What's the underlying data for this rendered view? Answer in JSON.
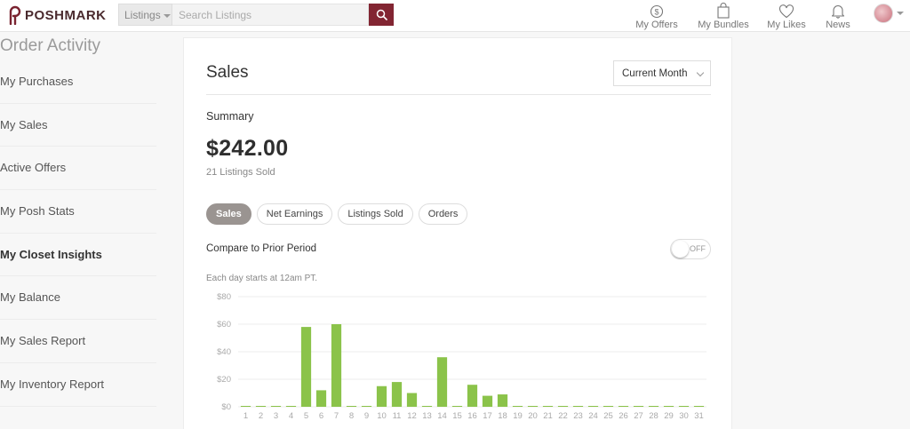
{
  "header": {
    "logo_text": "POSHMARK",
    "search_category": "Listings",
    "search_placeholder": "Search Listings",
    "nav": [
      {
        "label": "My Offers",
        "icon": "offers-icon"
      },
      {
        "label": "My Bundles",
        "icon": "bundle-icon"
      },
      {
        "label": "My Likes",
        "icon": "heart-icon"
      },
      {
        "label": "News",
        "icon": "bell-icon"
      }
    ]
  },
  "sidebar": {
    "title": "Order Activity",
    "items": [
      {
        "label": "My Purchases",
        "bold": false
      },
      {
        "label": "My Sales",
        "bold": false
      },
      {
        "label": "Active Offers",
        "bold": false
      },
      {
        "label": "My Posh Stats",
        "bold": false
      },
      {
        "label": "My Closet Insights",
        "bold": true
      },
      {
        "label": "My Balance",
        "bold": false
      },
      {
        "label": "My Sales Report",
        "bold": false
      },
      {
        "label": "My Inventory Report",
        "bold": false
      }
    ]
  },
  "main": {
    "title": "Sales",
    "period": "Current Month",
    "summary_label": "Summary",
    "amount": "$242.00",
    "listings_sold": "21 Listings Sold",
    "tabs": [
      "Sales",
      "Net Earnings",
      "Listings Sold",
      "Orders"
    ],
    "active_tab": 0,
    "compare_label": "Compare to Prior Period",
    "compare_toggle": "OFF",
    "note": "Each day starts at 12am PT."
  },
  "colors": {
    "brand": "#822532",
    "bar": "#8bc34a",
    "active_pill": "#9a9491"
  },
  "chart_data": {
    "type": "bar",
    "categories": [
      "1",
      "2",
      "3",
      "4",
      "5",
      "6",
      "7",
      "8",
      "9",
      "10",
      "11",
      "12",
      "13",
      "14",
      "15",
      "16",
      "17",
      "18",
      "19",
      "20",
      "21",
      "22",
      "23",
      "24",
      "25",
      "26",
      "27",
      "28",
      "29",
      "30",
      "31"
    ],
    "values": [
      0,
      0,
      0,
      0,
      58,
      12,
      60,
      0,
      0,
      15,
      18,
      10,
      0,
      36,
      0,
      16,
      8,
      9,
      0,
      0,
      0,
      0,
      0,
      0,
      0,
      0,
      0,
      0,
      0,
      0,
      0
    ],
    "ylim": [
      0,
      80
    ],
    "yticks": [
      "$0",
      "$20",
      "$40",
      "$60",
      "$80"
    ],
    "title": "",
    "xlabel": "",
    "ylabel": "",
    "grid": true
  }
}
